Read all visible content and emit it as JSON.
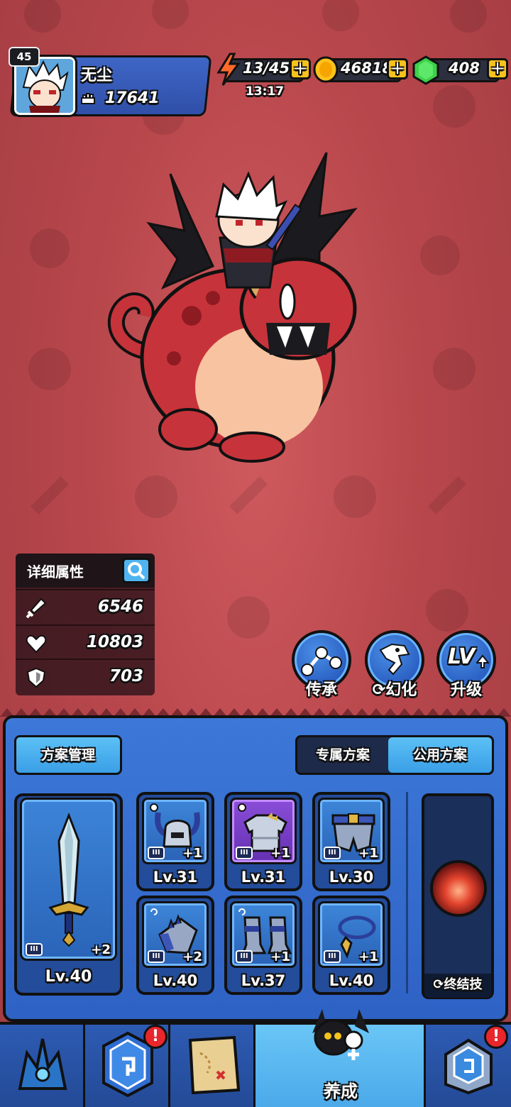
{
  "player": {
    "level": "45",
    "name": "无尘",
    "power": "17641"
  },
  "resources": {
    "energy": "13/45",
    "energy_timer": "13:17",
    "gold": "46818",
    "gems": "408",
    "plus_symbol": "+"
  },
  "attributes": {
    "title": "详细属性",
    "attack": "6546",
    "health": "10803",
    "defense": "703"
  },
  "actions": {
    "inherit": "传承",
    "transform": "幻化",
    "upgrade": "升级",
    "upgrade_icon_text": "LV"
  },
  "plans": {
    "manage_label": "方案管理",
    "tab_exclusive": "专属方案",
    "tab_public": "公用方案",
    "active_tab": "公用方案"
  },
  "equipment": {
    "weapon": {
      "tier": "III",
      "plus": "+2",
      "level": "Lv.40"
    },
    "slots": [
      {
        "name": "helmet",
        "tier": "III",
        "plus": "+1",
        "level": "Lv.31"
      },
      {
        "name": "armor",
        "tier": "III",
        "plus": "+1",
        "level": "Lv.31"
      },
      {
        "name": "belt",
        "tier": "III",
        "plus": "+1",
        "level": "Lv.30"
      },
      {
        "name": "gloves",
        "tier": "III",
        "plus": "+2",
        "level": "Lv.40"
      },
      {
        "name": "boots",
        "tier": "III",
        "plus": "+1",
        "level": "Lv.37"
      },
      {
        "name": "necklace",
        "tier": "III",
        "plus": "+1",
        "level": "Lv.40"
      }
    ],
    "ultimate_label": "终结技"
  },
  "nav": {
    "cultivate_label": "养成",
    "alert_symbol": "!"
  }
}
